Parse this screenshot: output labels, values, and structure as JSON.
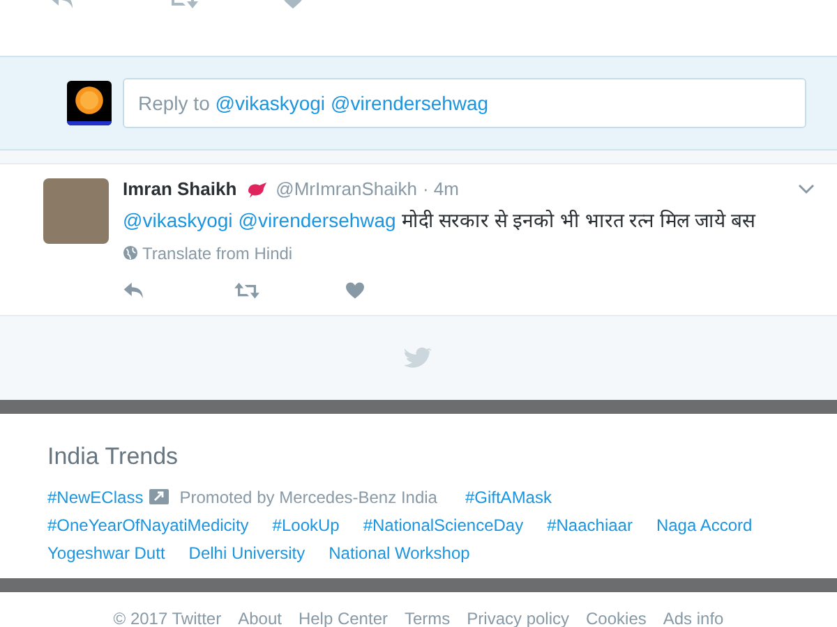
{
  "reply_box": {
    "placeholder_prefix": "Reply to",
    "mentions": [
      "@vikaskyogi",
      "@virendersehwag"
    ]
  },
  "tweet": {
    "name": "Imran Shaikh",
    "handle": "@MrImranShaikh",
    "time": "· 4m",
    "mentions": [
      "@vikaskyogi",
      "@virendersehwag"
    ],
    "text": "मोदी सरकार से इनको भी भारत रत्न मिल जाये बस",
    "translate": "Translate from Hindi"
  },
  "trends": {
    "title": "India Trends",
    "items": [
      {
        "kind": "promoted",
        "label": "#NewEClass",
        "promoted_by": "Promoted by Mercedes-Benz India"
      },
      {
        "kind": "trend",
        "label": "#GiftAMask"
      },
      {
        "kind": "trend",
        "label": "#OneYearOfNayatiMedicity"
      },
      {
        "kind": "trend",
        "label": "#LookUp"
      },
      {
        "kind": "trend",
        "label": "#NationalScienceDay"
      },
      {
        "kind": "trend",
        "label": "#Naachiaar"
      },
      {
        "kind": "trend",
        "label": "Naga Accord"
      },
      {
        "kind": "trend",
        "label": "Yogeshwar Dutt"
      },
      {
        "kind": "trend",
        "label": "Delhi University"
      },
      {
        "kind": "trend",
        "label": "National Workshop"
      }
    ]
  },
  "footer_links": [
    "© 2017 Twitter",
    "About",
    "Help Center",
    "Terms",
    "Privacy policy",
    "Cookies",
    "Ads info"
  ]
}
